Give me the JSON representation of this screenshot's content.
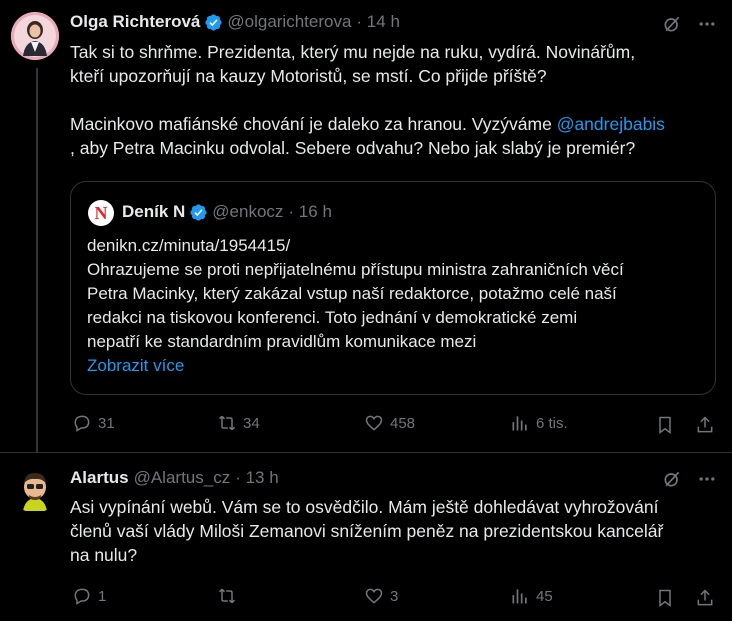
{
  "tweet1": {
    "author_name": "Olga Richterová",
    "handle": "@olgarichterova",
    "time": "· 14 h",
    "line1": "Tak si to shrňme. Prezidenta, který mu nejde na ruku, vydírá. Novinářům,",
    "line2": "kteří upozorňují na kauzy Motoristů, se mstí. Co přijde příště?",
    "line3a": "Macinkovo mafiánské chování je daleko za hranou. Vyzýváme ",
    "mention": "@andrejbabis",
    "line4": ", aby Petra Macinku odvolal. Sebere odvahu? Nebo jak slabý je premiér?",
    "quote": {
      "logo_letter": "N",
      "author_name": "Deník N",
      "handle": "@enkocz",
      "time": "· 16 h",
      "url_line": "denikn.cz/minuta/1954415/",
      "line1": "Ohrazujeme se proti nepřijatelnému přístupu ministra zahraničních věcí",
      "line2": "Petra Macinky, který zakázal vstup naší redaktorce, potažmo celé naší",
      "line3": "redakci na tiskovou konferenci. Toto jednání v demokratické zemi",
      "line4": "nepatří ke standardním pravidlům komunikace mezi",
      "show_more": "Zobrazit více"
    },
    "replies": "31",
    "reposts": "34",
    "likes": "458",
    "views": "6 tis."
  },
  "tweet2": {
    "author_name": "Alartus",
    "handle": "@Alartus_cz",
    "time": "· 13 h",
    "line1": "Asi vypínání webů. Vám se to osvědčilo. Mám ještě dohledávat vyhrožování",
    "line2": "členů vaší vlády Miloši Zemanovi snížením peněz na prezidentskou kancelář",
    "line3": "na nulu?",
    "replies": "1",
    "likes": "3",
    "views": "45"
  },
  "colors": {
    "background": "#000000",
    "text": "#e7e9ea",
    "muted": "#71767b",
    "accent": "#1d9bf0",
    "denikn_red": "#e0262b"
  }
}
